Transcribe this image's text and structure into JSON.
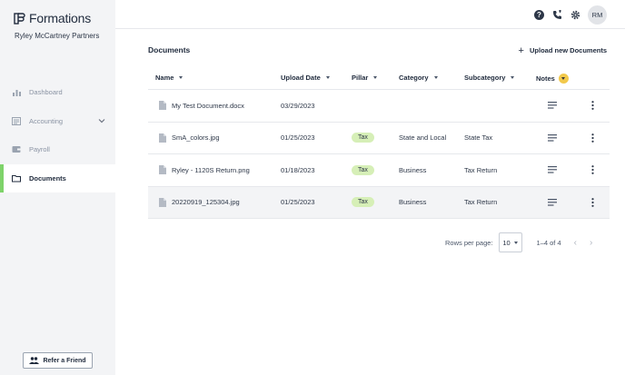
{
  "brand": {
    "name": "Formations",
    "company": "Ryley McCartney Partners"
  },
  "sidebar": {
    "items": [
      {
        "label": "Dashboard",
        "icon": "bar-chart-icon"
      },
      {
        "label": "Accounting",
        "icon": "ledger-icon"
      },
      {
        "label": "Payroll",
        "icon": "wallet-icon"
      },
      {
        "label": "Documents",
        "icon": "folder-icon",
        "active": true
      }
    ],
    "refer_label": "Refer a Friend"
  },
  "topbar": {
    "avatar_initials": "RM"
  },
  "main": {
    "title": "Documents",
    "upload_label": "Upload new Documents",
    "columns": {
      "name": "Name",
      "upload_date": "Upload Date",
      "pillar": "Pillar",
      "category": "Category",
      "subcategory": "Subcategory",
      "notes": "Notes"
    },
    "rows": [
      {
        "name": "My Test Document.docx",
        "date": "03/29/2023",
        "pillar": "",
        "category": "",
        "subcategory": ""
      },
      {
        "name": "SmA_colors.jpg",
        "date": "01/25/2023",
        "pillar": "Tax",
        "category": "State and Local",
        "subcategory": "State Tax"
      },
      {
        "name": "Ryley - 1120S Return.png",
        "date": "01/18/2023",
        "pillar": "Tax",
        "category": "Business",
        "subcategory": "Tax Return"
      },
      {
        "name": "20220919_125304.jpg",
        "date": "01/25/2023",
        "pillar": "Tax",
        "category": "Business",
        "subcategory": "Tax Return"
      }
    ],
    "pagination": {
      "rows_per_page_label": "Rows per page:",
      "rows_per_page": "10",
      "range": "1–4 of 4"
    }
  },
  "colors": {
    "accent_green": "#7ed36a",
    "pill_green": "#d6efb7",
    "notes_badge": "#f2c94c"
  }
}
